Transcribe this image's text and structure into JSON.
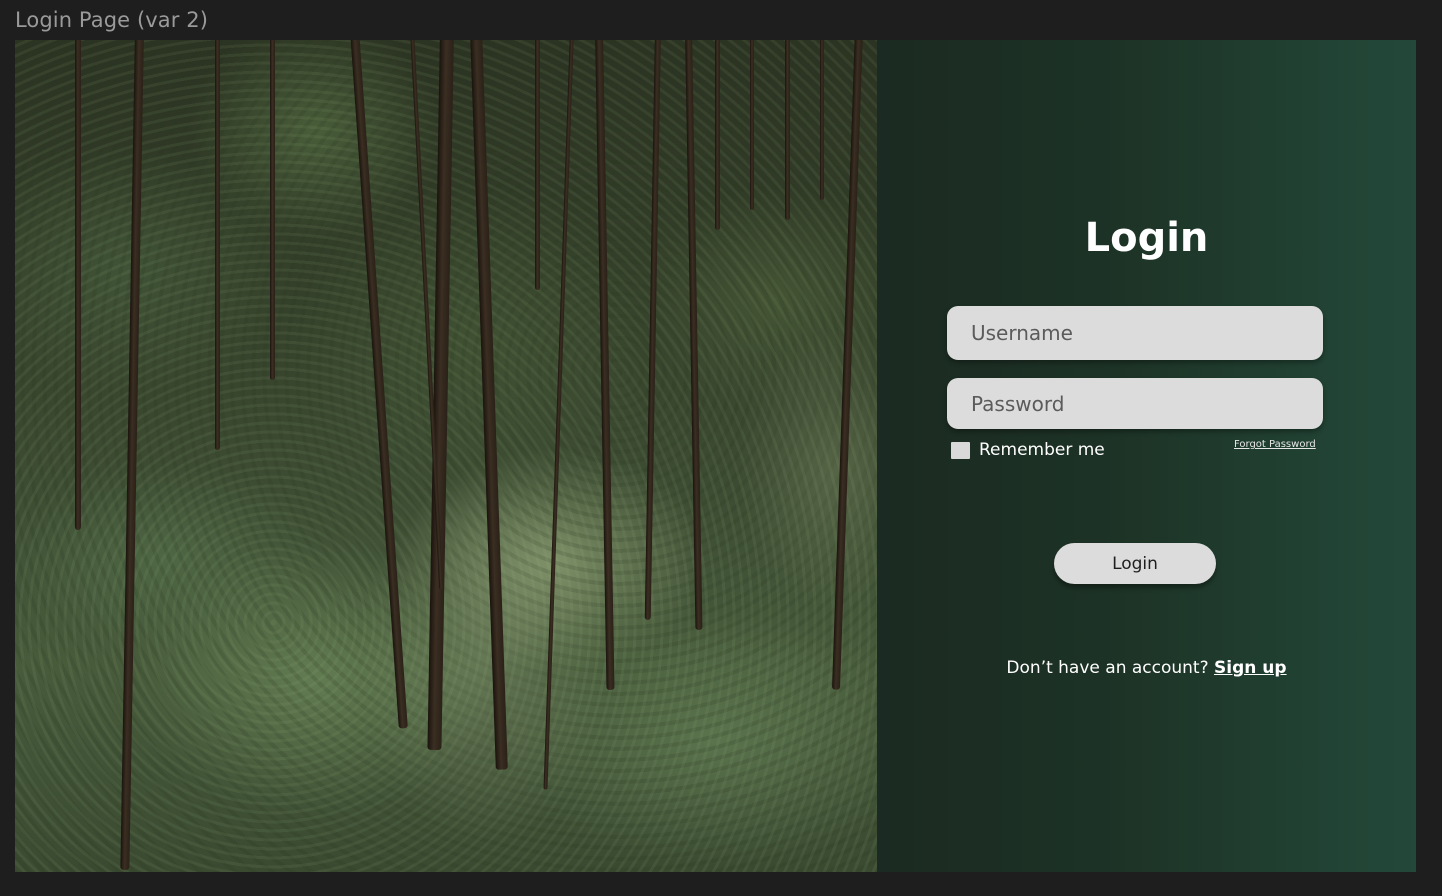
{
  "frame": {
    "label": "Login Page (var 2)"
  },
  "image": {
    "subject": "forest-photo"
  },
  "form": {
    "title": "Login",
    "username_placeholder": "Username",
    "password_placeholder": "Password",
    "remember_label": "Remember me",
    "remember_checked": false,
    "forgot_label": "Forgot Password",
    "login_button": "Login",
    "signup_prompt": "Don’t have an account?",
    "signup_link": "Sign up"
  },
  "colors": {
    "panel_gradient_start": "#1b2a22",
    "panel_gradient_end": "#23493a",
    "input_bg": "#dcdcdc",
    "button_bg": "#dcdcdc",
    "canvas_bg": "#1e1e1e"
  }
}
